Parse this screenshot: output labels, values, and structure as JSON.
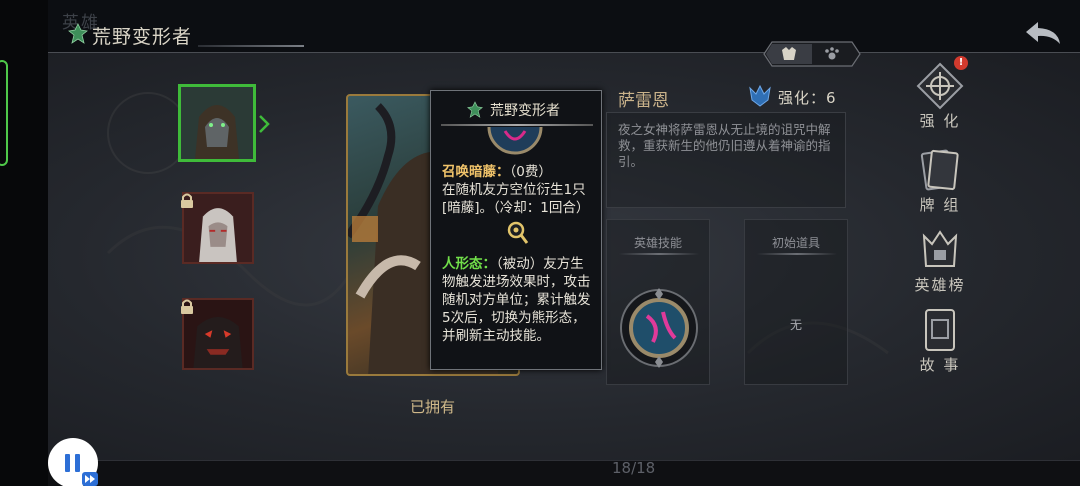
{
  "background_tab": "英雄",
  "header": {
    "title": "荒野变形者",
    "leaf_icon": "leaf-icon",
    "back_icon": "back-arrow-icon"
  },
  "tabs": {
    "left_icon": "boss-helmet-icon",
    "right_icon": "paw-icon"
  },
  "roster": [
    {
      "icon": "hooded-druid-portrait",
      "selected": true,
      "locked": false
    },
    {
      "icon": "pale-vampire-portrait",
      "selected": false,
      "locked": true
    },
    {
      "icon": "demon-beast-portrait",
      "selected": false,
      "locked": true
    }
  ],
  "card": {
    "owned_label": "已拥有"
  },
  "tooltip": {
    "title": "荒野变形者",
    "skill1_name": "召唤暗藤：",
    "skill1_cost": "（0费）",
    "skill1_text": "在随机友方空位衍生1只[暗藤]。（冷却：1回合）",
    "skill2_name": "人形态：",
    "skill2_type": "（被动）",
    "skill2_text": "友方生物触发进场效果时，攻击随机对方单位；累计触发5次后，切换为熊形态，并刷新主动技能。"
  },
  "hero": {
    "name": "萨雷恩",
    "strength_label": "强化：6",
    "description": "夜之女神将萨雷恩从无止境的诅咒中解救，重获新生的他仍旧遵从着神谕的指引。"
  },
  "slots": {
    "skill_title": "英雄技能",
    "item_title": "初始道具",
    "item_empty": "无"
  },
  "side_menu": [
    {
      "label": "强 化",
      "icon": "enhance-icon",
      "badge": "!"
    },
    {
      "label": "牌 组",
      "icon": "card-deck-icon",
      "badge": ""
    },
    {
      "label": "英雄榜",
      "icon": "hero-ranking-icon",
      "badge": ""
    },
    {
      "label": "故 事",
      "icon": "story-book-icon",
      "badge": ""
    }
  ],
  "footer": {
    "page_count": "18/18"
  },
  "colors": {
    "selected_border": "#3fbb3a",
    "gold_text": "#f0c36a",
    "green_text": "#72e04a",
    "alert_red": "#d23a2e"
  }
}
